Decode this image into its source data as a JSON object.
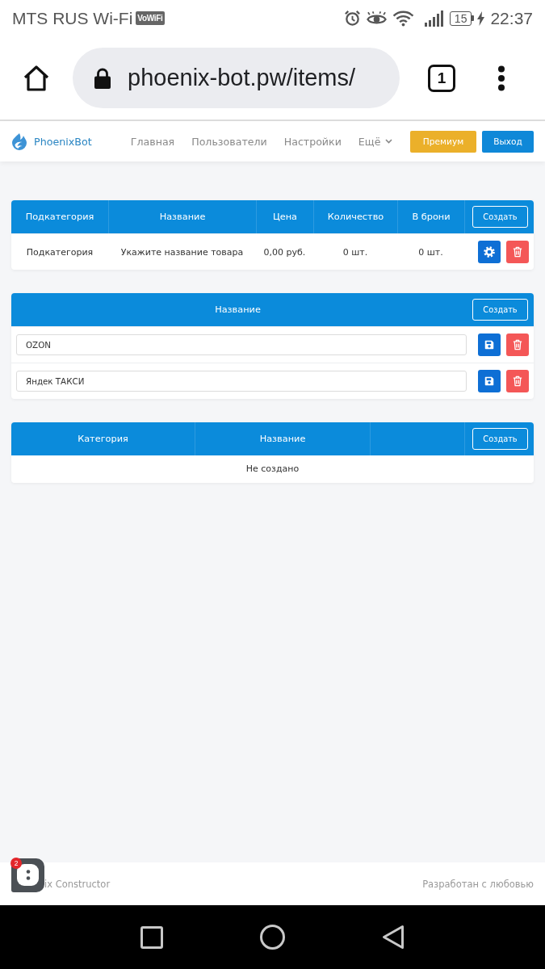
{
  "status_bar": {
    "carrier": "MTS RUS Wi-Fi",
    "vowifi_badge": "VoWiFi",
    "battery": "15",
    "time": "22:37"
  },
  "browser": {
    "url": "phoenix-bot.pw/items/",
    "tab_count": "1"
  },
  "navbar": {
    "brand": "PhoenixBot",
    "links": [
      {
        "label": "Главная",
        "kind": "link"
      },
      {
        "label": "Пользователи",
        "kind": "link"
      },
      {
        "label": "Настройки",
        "kind": "link"
      },
      {
        "label": "Ещё",
        "kind": "dropdown"
      }
    ],
    "buttons": [
      {
        "label": "Премиум",
        "kind": "premium"
      },
      {
        "label": "Выход",
        "kind": "primary"
      }
    ]
  },
  "items_table": {
    "columns": [
      "Подкатегория",
      "Название",
      "Цена",
      "Количество",
      "В брони"
    ],
    "create_button": "Создать",
    "rows": [
      {
        "cells": [
          "Подкатегория",
          "Укажите название товара",
          "0,00 руб.",
          "0 шт.",
          "0 шт."
        ]
      }
    ]
  },
  "names_table": {
    "columns": [
      "Название"
    ],
    "create_button": "Создать",
    "rows": [
      {
        "value": "OZON"
      },
      {
        "value": "Яндек ТАКСИ"
      }
    ]
  },
  "categories_table": {
    "columns": [
      "Категория",
      "Название"
    ],
    "create_button": "Создать",
    "empty_text": "Не создано"
  },
  "footer": {
    "left_text": "ix Constructor",
    "right_text": "Разработан с любовью"
  },
  "chat_widget": {
    "badge": "2"
  }
}
